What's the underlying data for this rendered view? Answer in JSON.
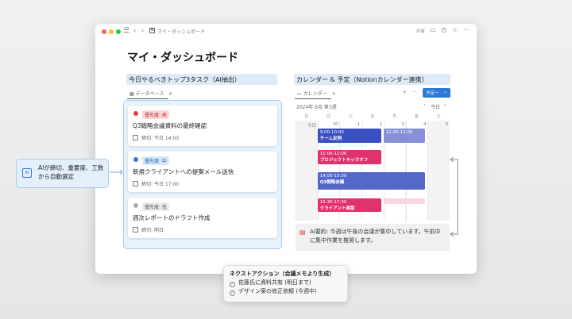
{
  "window": {
    "breadcrumb": "マイ・ダッシュボード",
    "share": "共有",
    "page_title": "マイ・ダッシュボード"
  },
  "tasks": {
    "heading": "今日やるべきトップ3タスク（AI抽出）",
    "tab": "データベース",
    "add": "+",
    "items": [
      {
        "priority": "優先度: 高",
        "title": "Q3戦略会議資料の最終確認",
        "due": "締切: 今日 14:00",
        "color": "#e03e3e"
      },
      {
        "priority": "優先度: 中",
        "title": "新規クライアントへの提案メール送信",
        "due": "締切: 今日 17:00",
        "color": "#2f7ad8"
      },
      {
        "priority": "優先度: 低",
        "title": "週次レポートのドラフト作成",
        "due": "締切: 明日",
        "color": "#999999"
      }
    ]
  },
  "calendar": {
    "heading": "カレンダー & 予定（Notionカレンダー連携）",
    "tab": "カレンダー",
    "add": "+",
    "more": "···",
    "new_button": "予定ー",
    "week": "2024年 6月 第3週",
    "today": "今日",
    "weekdays": [
      "日",
      "月",
      "火",
      "水",
      "木",
      "金",
      "土"
    ],
    "dates": [
      "今日",
      "20",
      "1",
      "2",
      "3",
      "4",
      "5"
    ],
    "events": [
      {
        "time": "9:00-10:00",
        "title": "チーム定例",
        "color": "#3a4fc1"
      },
      {
        "time": "11:00-12:00",
        "title": "",
        "color": "#8590d6"
      },
      {
        "time": "11:00-12:00",
        "title": "プロジェクトキックオフ",
        "color": "#e0336b"
      },
      {
        "time": "14:00-15:30",
        "title": "Q3戦略会議",
        "color": "#5468c9"
      },
      {
        "time": "16:30-17:30",
        "title": "クライアント面談",
        "color": "#e0336b"
      }
    ],
    "summary": "AI要約: 今週は午後の会議が集中しています。午前中に集中作業を推奨します。"
  },
  "callout": {
    "text": "AIが締切、重要度、工数から自動選定",
    "icon": "ai-chip-icon"
  },
  "next_actions": {
    "title": "ネクストアクション（会議メモより生成）",
    "items": [
      "佐藤氏に資料共有 (明日まで)",
      "デザイン案の修正依頼 (今週中)"
    ]
  }
}
